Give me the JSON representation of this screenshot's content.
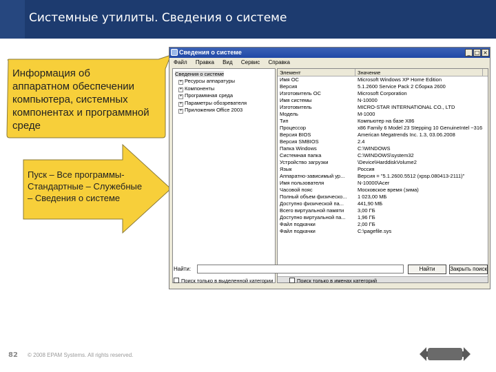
{
  "slide": {
    "title": "Системные утилиты. Сведения о системе",
    "callout_top": "Информация об аппаратном обеспечении компьютера, системных компонентах и программной среде",
    "callout_bottom": "Пуск – Все программы- Стандартные – Служебные – Сведения о системе",
    "page_number": "82",
    "copyright": "© 2008 EPAM Systems. All rights reserved.",
    "logo_text": "epam"
  },
  "window": {
    "title": "Сведения о системе",
    "controls": [
      "_",
      "□",
      "×"
    ],
    "menu": [
      "Файл",
      "Правка",
      "Вид",
      "Сервис",
      "Справка"
    ],
    "tree_root": "Сведения о системе",
    "tree_items": [
      "Ресурсы аппаратуры",
      "Компоненты",
      "Программная среда",
      "Параметры обозревателя",
      "Приложения Office 2003"
    ],
    "columns": [
      "Элемент",
      "Значение"
    ],
    "rows": [
      [
        "Имя ОС",
        "Microsoft Windows XP Home Edition"
      ],
      [
        "Версия",
        "5.1.2600 Service Pack 2 Сборка 2600"
      ],
      [
        "Изготовитель ОС",
        "Microsoft Corporation"
      ],
      [
        "Имя системы",
        "N-10000"
      ],
      [
        "Изготовитель",
        "MICRO-STAR INTERNATIONAL CO., LTD"
      ],
      [
        "Модель",
        "M-1000"
      ],
      [
        "Тип",
        "Компьютер на базе X86"
      ],
      [
        "Процессор",
        "x86 Family 6 Model 23 Stepping 10 GenuineIntel ~316"
      ],
      [
        "Версия BIOS",
        "American Megatrends Inc. 1.3, 03.06.2008"
      ],
      [
        "Версия SMBIOS",
        "2.4"
      ],
      [
        "Папка Windows",
        "C:\\WINDOWS"
      ],
      [
        "Системная папка",
        "C:\\WINDOWS\\system32"
      ],
      [
        "Устройство загрузки",
        "\\Device\\HarddiskVolume2"
      ],
      [
        "Язык",
        "Россия"
      ],
      [
        "Аппаратно-зависимый ур...",
        "Версия = \"5.1.2600.5512 (xpsp.080413-2111)\""
      ],
      [
        "Имя пользователя",
        "N-10000\\Acer"
      ],
      [
        "Часовой пояс",
        "Московское время (зима)"
      ],
      [
        "Полный объем физическо...",
        "1 023,00 МБ"
      ],
      [
        "Доступно физической па...",
        "441,90 МБ"
      ],
      [
        "Всего виртуальной памяти",
        "3,00 ГБ"
      ],
      [
        "Доступно виртуальной па...",
        "1,96 ГБ"
      ],
      [
        "Файл подкачки",
        "2,00 ГБ"
      ],
      [
        "Файл подкачки",
        "C:\\pagefile.sys"
      ]
    ],
    "find_label": "Найти:",
    "find_value": "",
    "find_button": "Найти",
    "close_find_button": "Закрыть поиск",
    "check_selected": "Поиск только в выделенной категории",
    "check_names": "Поиск только в именах категорий"
  }
}
